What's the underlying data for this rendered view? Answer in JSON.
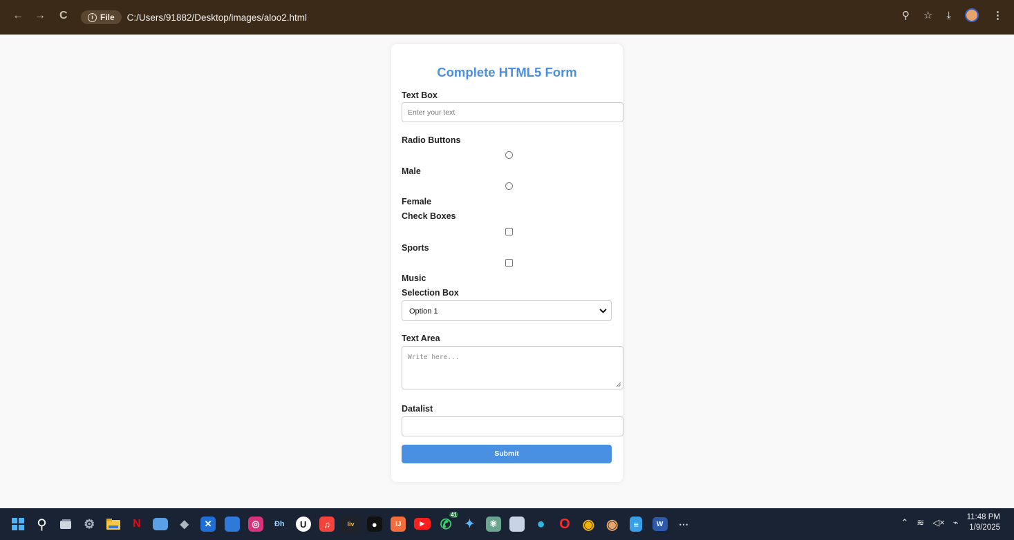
{
  "browser": {
    "back_icon": "←",
    "forward_icon": "→",
    "reload_icon": "C",
    "file_chip": "File",
    "url": "C:/Users/91882/Desktop/images/aloo2.html"
  },
  "form": {
    "title": "Complete HTML5 Form",
    "text_box": {
      "label": "Text Box",
      "placeholder": "Enter your text"
    },
    "radio": {
      "label": "Radio Buttons",
      "options": [
        "Male",
        "Female"
      ]
    },
    "checks": {
      "label": "Check Boxes",
      "options": [
        "Sports",
        "Music"
      ]
    },
    "select": {
      "label": "Selection Box",
      "value": "Option 1"
    },
    "textarea": {
      "label": "Text Area",
      "placeholder": "Write here..."
    },
    "datalist": {
      "label": "Datalist",
      "value": ""
    },
    "submit": "Submit"
  },
  "taskbar": {
    "apps": [
      "start",
      "search",
      "task-view",
      "settings",
      "file-explorer",
      "netflix",
      "photos",
      "unity",
      "vscode",
      "calendar",
      "instagram",
      "edge-dev",
      "uber",
      "music",
      "sony-liv",
      "capcut",
      "intellij",
      "youtube",
      "whatsapp",
      "copilot",
      "chatgpt",
      "paint",
      "edge",
      "opera",
      "chrome",
      "chrome-profile",
      "notepad",
      "word"
    ],
    "whatsapp_badge": "41",
    "more": "⋯",
    "time": "11:48 PM",
    "date": "1/9/2025"
  },
  "colors": {
    "accent": "#4a90e2",
    "browser_bar": "#3b2a17",
    "taskbar": "#1a2333"
  }
}
